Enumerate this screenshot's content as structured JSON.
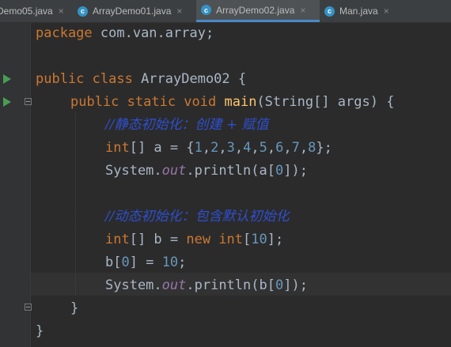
{
  "tabs": [
    {
      "label": "Demo05.java",
      "active": false
    },
    {
      "label": "ArrayDemo01.java",
      "active": false
    },
    {
      "label": "ArrayDemo02.java",
      "active": true
    },
    {
      "label": "Man.java",
      "active": false
    }
  ],
  "tab_icon_letter": "c",
  "close_glyph": "×",
  "code": {
    "l1_kw": "package",
    "l1_rest": " com.van.array;",
    "l3_kw": "public class",
    "l3_rest": " ArrayDemo02 {",
    "l4_kw1": "public static void",
    "l4_fn": "main",
    "l4_rest": "(String[] args) {",
    "l5_comment": "//静态初始化：创建 + 赋值",
    "l6_kw": "int",
    "l6_a": "[] a = {",
    "l6_n1": "1",
    "l6_n2": "2",
    "l6_n3": "3",
    "l6_n4": "4",
    "l6_n5": "5",
    "l6_n6": "6",
    "l6_n7": "7",
    "l6_n8": "8",
    "comma": ",",
    "l6_end": "};",
    "l7_sys": "System.",
    "l7_out": "out",
    "l7_call": ".println(a[",
    "l7_num": "0",
    "l7_end": "]);",
    "l9_comment": "//动态初始化：包含默认初始化",
    "l10_kw1": "int",
    "l10_mid": "[] b = ",
    "l10_kw2": "new int",
    "l10_br": "[",
    "l10_num": "10",
    "l10_end": "];",
    "l11_pre": "b[",
    "l11_idx": "0",
    "l11_mid": "] = ",
    "l11_val": "10",
    "l11_end": ";",
    "l12_sys": "System.",
    "l12_out": "out",
    "l12_call": ".println(b[",
    "l12_num": "0",
    "l12_end": "]);",
    "l13": "}",
    "l14": "}"
  },
  "colors": {
    "background": "#2b2b2b",
    "keyword": "#cc7832",
    "method": "#ffc66d",
    "number": "#6897bb",
    "field": "#9876aa",
    "comment": "#2f4fcf",
    "text": "#a9b7c6",
    "run_icon": "#499c54"
  }
}
